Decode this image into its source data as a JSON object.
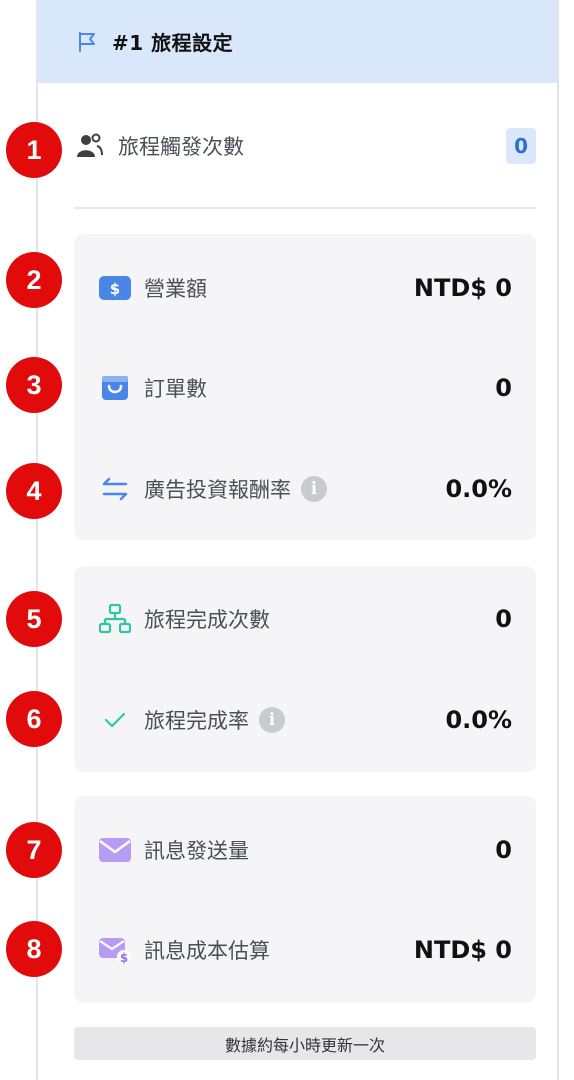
{
  "header": {
    "title": "#1 旅程設定",
    "icon": "flag-icon",
    "accent": "#4a86e8"
  },
  "trigger": {
    "label": "旅程觸發次數",
    "count": "0",
    "icon": "users-icon"
  },
  "revenue_card": {
    "revenue": {
      "label": "營業額",
      "value": "NTD$ 0",
      "icon": "dollar-icon"
    },
    "orders": {
      "label": "訂單數",
      "value": "0",
      "icon": "shopping-bag-icon"
    },
    "roas": {
      "label": "廣告投資報酬率",
      "value": "0.0%",
      "icon": "swap-arrows-icon",
      "info": "i"
    }
  },
  "journey_card": {
    "completions": {
      "label": "旅程完成次數",
      "value": "0",
      "icon": "flow-tree-icon"
    },
    "completion_rate": {
      "label": "旅程完成率",
      "value": "0.0%",
      "icon": "check-icon",
      "info": "i"
    }
  },
  "message_card": {
    "sent": {
      "label": "訊息發送量",
      "value": "0",
      "icon": "envelope-icon"
    },
    "cost": {
      "label": "訊息成本估算",
      "value": "NTD$ 0",
      "icon": "envelope-dollar-icon"
    }
  },
  "footer": {
    "note": "數據約每小時更新一次"
  },
  "badges": [
    "1",
    "2",
    "3",
    "4",
    "5",
    "6",
    "7",
    "8"
  ]
}
